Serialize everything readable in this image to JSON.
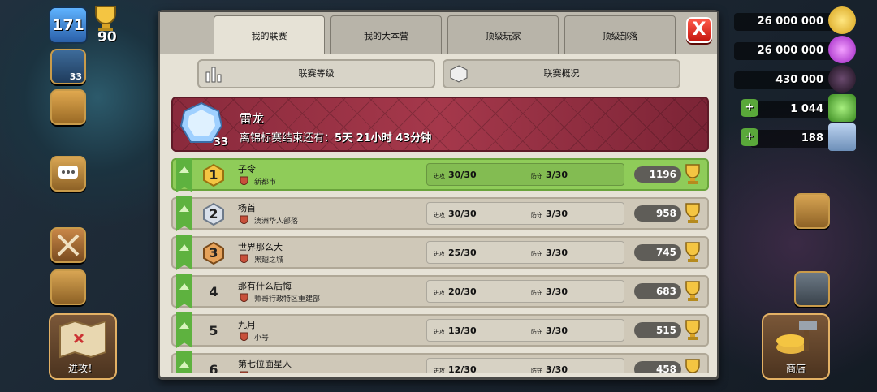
{
  "hud": {
    "level": "171",
    "trophies": "90",
    "player_tag": "子令",
    "builder_level": "33",
    "gold": "26 000 000",
    "elixir": "26 000 000",
    "dark_elixir": "430 000",
    "gems": "1 044",
    "builder_res": "188",
    "attack_label": "进攻！",
    "shop_label": "商店",
    "colors": {
      "gold": "#f1c232",
      "elixir": "#c235e8",
      "dark": "#2a1b2c",
      "gem": "#4caf2e"
    }
  },
  "tabs": [
    {
      "label": "我的联赛",
      "active": true
    },
    {
      "label": "我的大本营",
      "active": false
    },
    {
      "label": "顶级玩家",
      "active": false
    },
    {
      "label": "顶级部落",
      "active": false
    }
  ],
  "close_label": "X",
  "subbuttons": {
    "league_tiers": "联赛等级",
    "league_overview": "联赛概况"
  },
  "league": {
    "name": "雷龙",
    "badge_level": "33",
    "countdown_prefix": "离锦标赛结束还有：",
    "countdown_value": "5天 21小时 43分钟",
    "color": "#a5384b"
  },
  "stat_labels": {
    "attack": "进攻",
    "defense": "防守"
  },
  "rows": [
    {
      "rank": "1",
      "name": "子令",
      "clan": "新都市",
      "attack": "30/30",
      "defense": "3/30",
      "score": "1196",
      "highlight": true
    },
    {
      "rank": "2",
      "name": "杨首",
      "clan": "澳洲华人部落",
      "attack": "30/30",
      "defense": "3/30",
      "score": "958",
      "highlight": false
    },
    {
      "rank": "3",
      "name": "世界那么大",
      "clan": "黑翅之城",
      "attack": "25/30",
      "defense": "3/30",
      "score": "745",
      "highlight": false
    },
    {
      "rank": "4",
      "name": "那有什么后悔",
      "clan": "师哥行政特区重建部",
      "attack": "20/30",
      "defense": "3/30",
      "score": "683",
      "highlight": false
    },
    {
      "rank": "5",
      "name": "九月",
      "clan": "小号",
      "attack": "13/30",
      "defense": "3/30",
      "score": "515",
      "highlight": false
    },
    {
      "rank": "6",
      "name": "第七位面星人",
      "clan": "",
      "attack": "12/30",
      "defense": "3/30",
      "score": "458",
      "highlight": false
    }
  ]
}
